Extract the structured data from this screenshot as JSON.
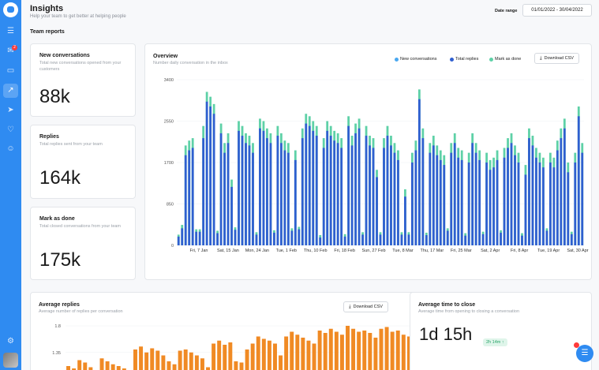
{
  "header": {
    "title": "Insights",
    "subtitle": "Help your team to get better at helping people",
    "date_label": "Date range",
    "date_value": "01/01/2022 - 30/04/2022"
  },
  "section_title": "Team reports",
  "stats": [
    {
      "title": "New conversations",
      "subtitle": "Total new conversations opened from your customers",
      "value": "88k"
    },
    {
      "title": "Replies",
      "subtitle": "Total replies sent from your team",
      "value": "164k"
    },
    {
      "title": "Mark as done",
      "subtitle": "Total closed conversations from your team",
      "value": "175k"
    }
  ],
  "overview": {
    "title": "Overview",
    "subtitle": "Number daily conversation in the inbox",
    "download_label": "Download CSV",
    "legend": [
      {
        "label": "New conversations",
        "color": "#4aa8f0"
      },
      {
        "label": "Total replies",
        "color": "#2f5fd0"
      },
      {
        "label": "Mark as done",
        "color": "#5ed1a7"
      }
    ]
  },
  "avg_replies": {
    "title": "Average replies",
    "subtitle": "Average number of replies per conversation",
    "download_label": "Download CSV"
  },
  "avg_close": {
    "title": "Average time to close",
    "subtitle": "Average time from opening to closing a conversation",
    "value": "1d 15h",
    "delta": "2h 14m ↑"
  },
  "sidebar": {
    "icons": [
      "inbox-icon",
      "notification-icon",
      "book-icon",
      "insights-icon",
      "send-icon",
      "like-icon",
      "users-icon",
      "settings-icon"
    ],
    "badge": "2"
  },
  "chart_data": [
    {
      "type": "bar",
      "title": "Overview",
      "ylim": [
        0,
        3400
      ],
      "yticks": [
        0,
        850,
        1700,
        2550,
        3400
      ],
      "xticks": [
        "Fri, 7 Jan",
        "Sat, 15 Jan",
        "Mon, 24 Jan",
        "Tue, 1 Feb",
        "Thu, 10 Feb",
        "Fri, 18 Feb",
        "Sun, 27 Feb",
        "Tue, 8 Mar",
        "Thu, 17 Mar",
        "Fri, 25 Mar",
        "Sat, 2 Apr",
        "Fri, 8 Apr",
        "Tue, 19 Apr",
        "Sat, 30 Apr"
      ],
      "series": [
        {
          "name": "Total replies",
          "values": [
            180,
            350,
            1850,
            1950,
            2000,
            280,
            280,
            2200,
            2950,
            2850,
            2700,
            250,
            2300,
            1900,
            2100,
            1200,
            320,
            2350,
            2250,
            2100,
            2050,
            1900,
            220,
            2400,
            2350,
            2200,
            2100,
            260,
            2250,
            2100,
            1950,
            1900,
            300,
            1750,
            330,
            2200,
            2500,
            2450,
            2350,
            2250,
            160,
            2000,
            2350,
            2250,
            2150,
            2100,
            2000,
            180,
            2450,
            2050,
            2300,
            2400,
            220,
            2250,
            2050,
            2000,
            1400,
            220,
            2000,
            2250,
            2050,
            1900,
            1750,
            220,
            1000,
            220,
            1700,
            1950,
            3000,
            2200,
            210,
            1900,
            2050,
            1850,
            1750,
            1650,
            300,
            1900,
            2100,
            1800,
            1750,
            200,
            1700,
            2100,
            1900,
            1750,
            230,
            1700,
            1550,
            1600,
            1750,
            260,
            1800,
            2000,
            2100,
            1850,
            1700,
            200,
            1450,
            2200,
            2050,
            1800,
            1700,
            1600,
            300,
            1700,
            1600,
            1950,
            2200,
            2400,
            1500,
            230,
            1700,
            2650,
            1900
          ],
          "colors": "#2f5fd0"
        },
        {
          "name": "Mark as done",
          "values": [
            220,
            420,
            2050,
            2150,
            2200,
            330,
            330,
            2450,
            3150,
            3050,
            2900,
            300,
            2500,
            2100,
            2300,
            1350,
            370,
            2550,
            2450,
            2300,
            2250,
            2100,
            270,
            2600,
            2550,
            2400,
            2300,
            310,
            2450,
            2300,
            2150,
            2100,
            350,
            1950,
            380,
            2400,
            2700,
            2650,
            2550,
            2450,
            210,
            2200,
            2550,
            2450,
            2350,
            2300,
            2200,
            230,
            2650,
            2250,
            2500,
            2600,
            270,
            2450,
            2250,
            2200,
            1550,
            270,
            2200,
            2450,
            2250,
            2100,
            1950,
            270,
            1150,
            270,
            1900,
            2150,
            3200,
            2400,
            260,
            2100,
            2250,
            2050,
            1950,
            1850,
            350,
            2100,
            2300,
            2000,
            1950,
            250,
            1900,
            2300,
            2100,
            1950,
            280,
            1900,
            1750,
            1800,
            1950,
            310,
            2000,
            2200,
            2300,
            2050,
            1900,
            250,
            1650,
            2400,
            2250,
            2000,
            1900,
            1800,
            350,
            1900,
            1800,
            2150,
            2400,
            2600,
            1700,
            280,
            1900,
            2850,
            2100
          ]
        }
      ]
    },
    {
      "type": "bar",
      "title": "Average replies",
      "ylim": [
        1.0,
        1.8
      ],
      "yticks": [
        1.35,
        1.8
      ],
      "series": [
        {
          "name": "Average replies",
          "values": [
            1.12,
            1.08,
            1.22,
            1.18,
            1.1,
            1.05,
            1.25,
            1.2,
            1.15,
            1.12,
            1.08,
            1.05,
            1.4,
            1.45,
            1.35,
            1.42,
            1.38,
            1.3,
            1.2,
            1.15,
            1.38,
            1.4,
            1.35,
            1.3,
            1.25,
            1.1,
            1.5,
            1.55,
            1.48,
            1.52,
            1.2,
            1.18,
            1.4,
            1.5,
            1.62,
            1.58,
            1.55,
            1.5,
            1.3,
            1.62,
            1.7,
            1.65,
            1.6,
            1.55,
            1.5,
            1.72,
            1.68,
            1.75,
            1.7,
            1.65,
            1.8,
            1.75,
            1.7,
            1.72,
            1.68,
            1.6,
            1.75,
            1.78,
            1.7,
            1.72,
            1.65,
            1.62,
            1.7
          ]
        }
      ]
    }
  ]
}
